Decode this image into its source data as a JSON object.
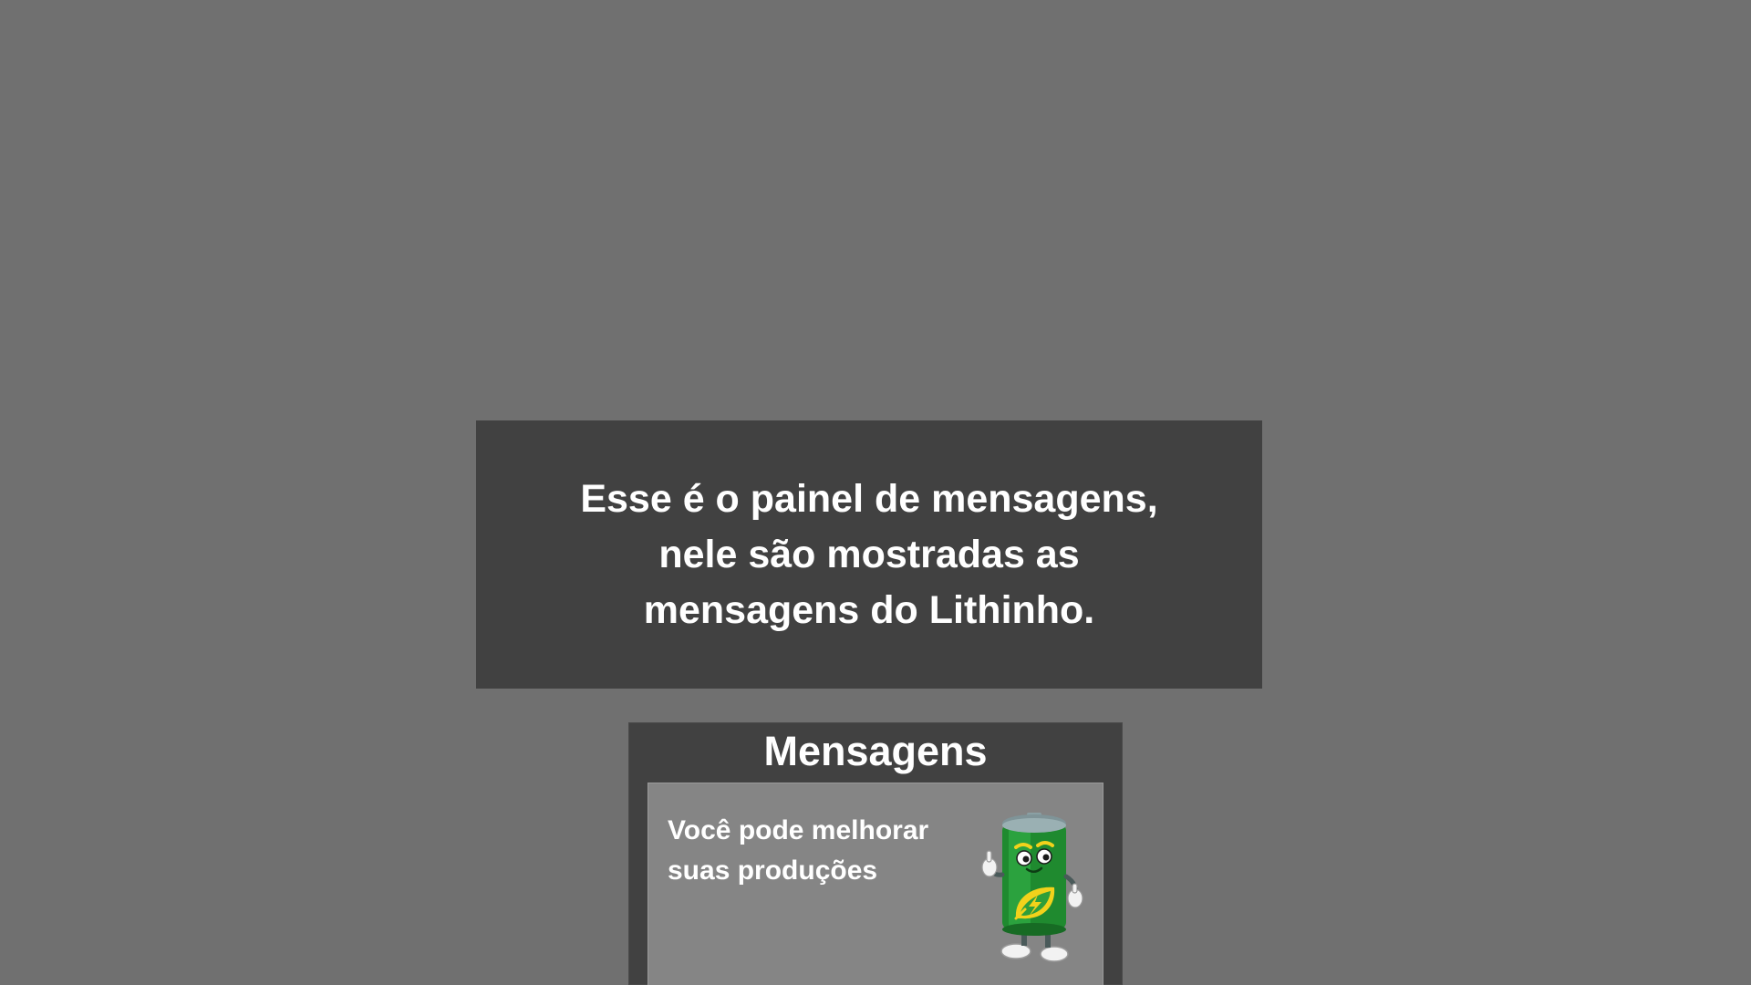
{
  "tutorial": {
    "text": "Esse é o painel de mensagens,\nnele são mostradas as\nmensagens do Lithinho."
  },
  "messages_panel": {
    "title": "Mensagens",
    "message": {
      "text": "Você pode melhorar\nsuas produções",
      "avatar_icon": "battery-mascot-icon"
    }
  },
  "colors": {
    "background": "#707070",
    "panel": "#414141",
    "card": "#858585",
    "text": "#ffffff",
    "mascot_body": "#2f9e3a",
    "mascot_leaf": "#f2d21b"
  }
}
